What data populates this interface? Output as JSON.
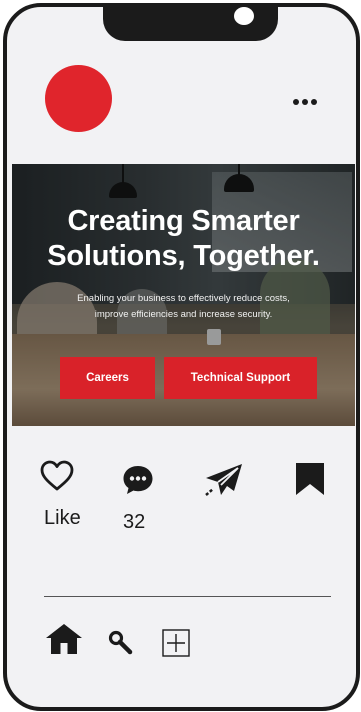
{
  "profile": {
    "avatar_color": "#e0252c",
    "more_icon": "more-horizontal-icon"
  },
  "hero": {
    "headline_line1": "Creating Smarter",
    "headline_line2": "Solutions, Together.",
    "subtext_line1": "Enabling your business to effectively reduce costs,",
    "subtext_line2": "improve efficiencies and increase security.",
    "buttons": [
      {
        "label": "Careers"
      },
      {
        "label": "Technical Support"
      }
    ],
    "accent_color": "#d92229"
  },
  "actions": {
    "like_label": "Like",
    "comment_count": "32",
    "icons": [
      "heart-icon",
      "comment-icon",
      "send-icon",
      "bookmark-icon"
    ]
  },
  "bottom_nav": {
    "icons": [
      "home-icon",
      "search-icon",
      "add-icon"
    ]
  }
}
